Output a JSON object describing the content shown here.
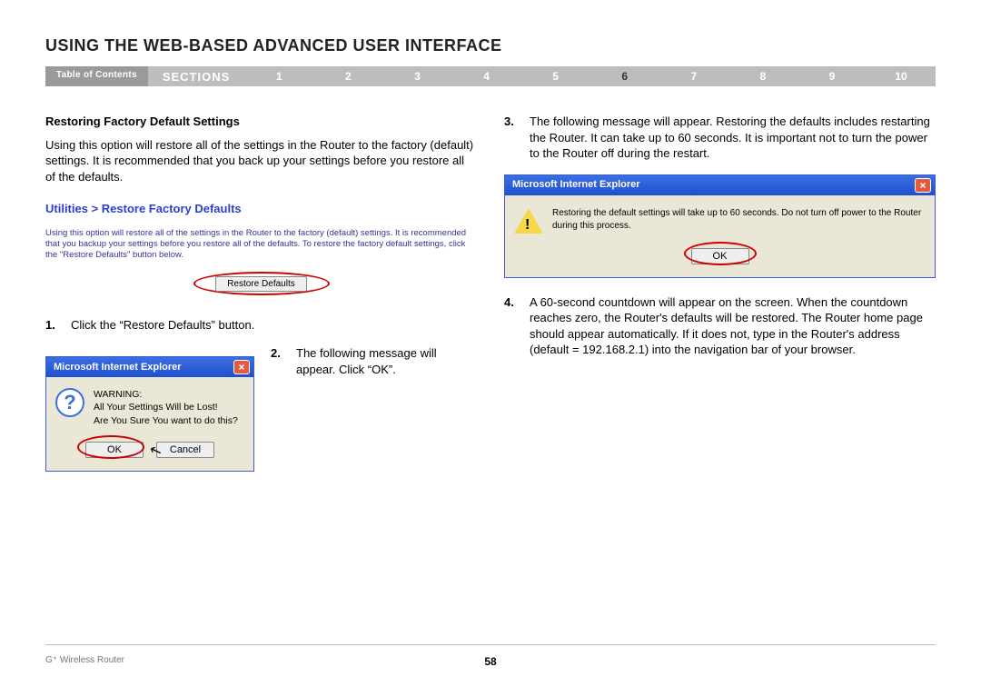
{
  "header": {
    "title": "USING THE WEB-BASED ADVANCED USER INTERFACE"
  },
  "nav": {
    "toc_label": "Table of Contents",
    "sections_label": "SECTIONS",
    "items": [
      "1",
      "2",
      "3",
      "4",
      "5",
      "6",
      "7",
      "8",
      "9",
      "10"
    ],
    "active_index": 5
  },
  "left": {
    "section_heading": "Restoring Factory Default Settings",
    "intro": "Using this option will restore all of the settings in the Router to the factory (default) settings. It is recommended that you back up your settings before you restore all of the defaults.",
    "restore_panel": {
      "breadcrumb": "Utilities > Restore Factory Defaults",
      "desc": "Using this option will restore all of the settings in the Router to the factory (default) settings. It is recommended that you backup your settings before you restore all of the defaults. To restore the factory default settings, click the \"Restore Defaults\" button below.",
      "button_label": "Restore Defaults"
    },
    "step1_num": "1.",
    "step1_text": "Click the “Restore Defaults” button.",
    "step2_num": "2.",
    "step2_text": "The following message will appear. Click “OK”.",
    "dialog1": {
      "title": "Microsoft Internet Explorer",
      "line1": "WARNING:",
      "line2": "All Your Settings Will be Lost!",
      "line3": "Are You Sure You want to do this?",
      "ok": "OK",
      "cancel": "Cancel"
    }
  },
  "right": {
    "step3_num": "3.",
    "step3_text": "The following message will appear. Restoring the defaults includes restarting the Router. It can take up to 60 seconds. It is important not to turn the power to the Router off during the restart.",
    "dialog2": {
      "title": "Microsoft Internet Explorer",
      "msg": "Restoring the default settings will take up to 60 seconds. Do not turn off power to the Router during this process.",
      "ok": "OK"
    },
    "step4_num": "4.",
    "step4_text": "A 60-second countdown will appear on the screen. When the countdown reaches zero, the Router's defaults will be restored. The Router home page should appear automatically. If it does not, type in the Router's address (default = 192.168.2.1) into the navigation bar of your browser."
  },
  "footer": {
    "left": "G⁺ Wireless Router",
    "page": "58"
  }
}
